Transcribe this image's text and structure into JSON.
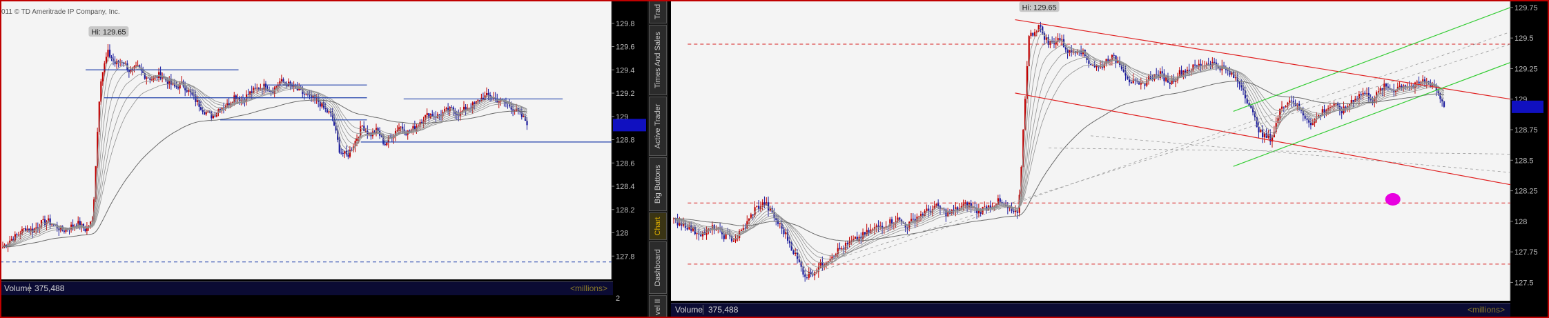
{
  "copyright": "011 © TD Ameritrade IP Company, Inc.",
  "side_tabs": [
    "Trad",
    "Times And Sales",
    "Active Trader",
    "Big Buttons",
    "Chart",
    "Dashboard",
    "vel II"
  ],
  "active_tab": "Chart",
  "volume": {
    "label": "Volume",
    "value": "375,488",
    "units": "<millions>"
  },
  "left_lower_axis_tick": "2",
  "colors": {
    "background": "#f4f4f4",
    "candle_up": "#c00000",
    "candle_down": "#1a1a9e",
    "ma_ribbon": "#909090",
    "support_resistance": "#1f3faa",
    "channel": "#e02020",
    "uptrend_channel": "#33cc33",
    "dashed_levels": "#d82020",
    "marker": "#e800e0",
    "price_tag": "#1010c0",
    "frame": "#c00000"
  },
  "chart_data": [
    {
      "type": "candlestick",
      "panel": "left",
      "high_label": "Hi: 129.65",
      "ylim": [
        127.6,
        130.0
      ],
      "y_ticks": [
        "129.8",
        "129.6",
        "129.4",
        "129.2",
        "129",
        "128.8",
        "128.6",
        "128.4",
        "128.2",
        "128",
        "127.8"
      ],
      "close_series": [
        127.88,
        127.94,
        127.98,
        128.04,
        128.02,
        128.08,
        128.1,
        128.06,
        128.02,
        128.05,
        128.08,
        128.03,
        128.1,
        129.3,
        129.55,
        129.45,
        129.48,
        129.38,
        129.42,
        129.35,
        129.32,
        129.36,
        129.3,
        129.25,
        129.28,
        129.2,
        129.12,
        129.04,
        129.0,
        129.08,
        129.1,
        129.18,
        129.14,
        129.2,
        129.24,
        129.26,
        129.22,
        129.3,
        129.28,
        129.24,
        129.2,
        129.16,
        129.14,
        129.06,
        129.0,
        128.7,
        128.66,
        128.78,
        128.92,
        128.84,
        128.88,
        128.76,
        128.84,
        128.92,
        128.86,
        128.9,
        128.98,
        129.02,
        129.0,
        129.04,
        129.06,
        129.02,
        129.08,
        129.1,
        129.16,
        129.18,
        129.14,
        129.12,
        129.08,
        129.02,
        128.95
      ],
      "support_resistance_levels": [
        {
          "price": 129.4,
          "x_range": [
            0.14,
            0.39
          ]
        },
        {
          "price": 129.16,
          "x_range": [
            0.17,
            0.6
          ]
        },
        {
          "price": 129.27,
          "x_range": [
            0.43,
            0.6
          ]
        },
        {
          "price": 128.97,
          "x_range": [
            0.36,
            0.6
          ]
        },
        {
          "price": 129.15,
          "x_range": [
            0.66,
            0.92
          ]
        },
        {
          "price": 128.78,
          "x_range": [
            0.59,
            1.0
          ]
        }
      ],
      "dashed_level": 127.75
    },
    {
      "type": "candlestick",
      "panel": "right",
      "high_label": "Hi: 129.65",
      "ylim": [
        127.35,
        129.8
      ],
      "y_ticks": [
        "129.75",
        "129.5",
        "129.25",
        "129",
        "128.75",
        "128.5",
        "128.25",
        "128",
        "127.75",
        "127.5"
      ],
      "close_series": [
        128.0,
        127.98,
        127.92,
        127.9,
        127.95,
        127.88,
        127.85,
        127.95,
        128.1,
        128.15,
        128.02,
        127.9,
        127.72,
        127.55,
        127.6,
        127.68,
        127.75,
        127.8,
        127.85,
        127.9,
        127.95,
        127.98,
        128.02,
        127.96,
        128.04,
        128.08,
        128.12,
        128.06,
        128.1,
        128.14,
        128.08,
        128.12,
        128.16,
        128.1,
        128.05,
        129.5,
        129.6,
        129.45,
        129.5,
        129.38,
        129.42,
        129.3,
        129.25,
        129.35,
        129.3,
        129.15,
        129.1,
        129.18,
        129.2,
        129.14,
        129.22,
        129.25,
        129.28,
        129.3,
        129.26,
        129.2,
        129.12,
        128.9,
        128.7,
        128.68,
        128.95,
        129.0,
        128.88,
        128.8,
        128.9,
        128.95,
        128.9,
        129.0,
        129.05,
        129.0,
        129.1,
        129.08,
        129.12,
        129.1,
        129.15,
        129.12,
        128.95
      ],
      "dashed_levels": [
        129.45,
        128.15,
        127.65
      ],
      "dashed_level_x_start": 0.02,
      "down_channel": {
        "upper": [
          [
            0.41,
            129.65
          ],
          [
            1.0,
            129.0
          ]
        ],
        "lower": [
          [
            0.41,
            129.05
          ],
          [
            1.0,
            128.3
          ]
        ]
      },
      "up_channel": {
        "upper": [
          [
            0.67,
            128.9
          ],
          [
            1.0,
            129.75
          ]
        ],
        "lower": [
          [
            0.67,
            128.45
          ],
          [
            1.0,
            129.3
          ]
        ]
      },
      "marker_point": [
        0.86,
        128.18
      ]
    }
  ]
}
